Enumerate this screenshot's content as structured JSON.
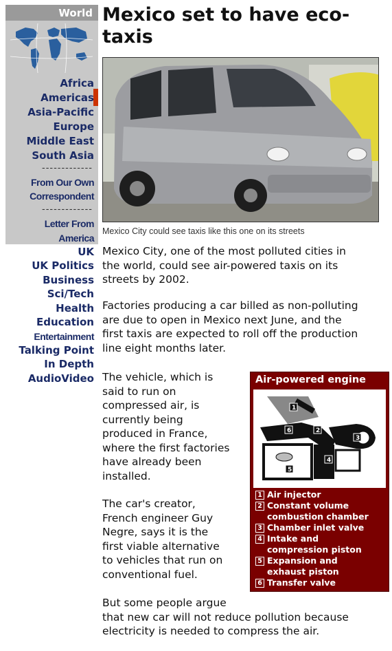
{
  "nav": {
    "world_label": "World",
    "regions": [
      "Africa",
      "Americas",
      "Asia-Pacific",
      "Europe",
      "Middle East",
      "South Asia"
    ],
    "dash_line": "-------------",
    "from_our_own": [
      "From Our Own",
      "Correspondent"
    ],
    "letter_from": [
      "Letter From",
      "America"
    ],
    "sections": [
      "UK",
      "UK Politics",
      "Business",
      "Sci/Tech",
      "Health",
      "Education",
      "Entertainment",
      "Talking Point",
      "In Depth",
      "AudioVideo"
    ],
    "active": "Americas"
  },
  "article": {
    "headline_line1": "Mexico set to have eco-",
    "headline_line2": "taxis",
    "photo_caption": "Mexico City could see taxis like this one on its streets",
    "paragraph1": "Mexico City, one of the most polluted cities in\nthe world, could see air-powered taxis on its\nstreets by 2002.",
    "paragraph2": "Factories producing a car billed as non-polluting\nare due to open in Mexico next June, and the\nfirst taxis are expected to roll off the production\nline eight months later.",
    "paragraph3": "The vehicle, which is\nsaid to run on\ncompressed air, is\ncurrently being\nproduced in France,\nwhere the first factories\nhave already been\ninstalled.",
    "paragraph4": "The car's creator,\nFrench engineer Guy\nNegre, says it is the\nfirst viable alternative\nto vehicles that run on\nconventional fuel.",
    "paragraph5": "But some people argue\nthat new car will not reduce pollution because\nelectricity is needed to compress the air."
  },
  "engine_box": {
    "title": "Air-powered engine",
    "diagram_numbers": [
      "1",
      "2",
      "3",
      "4",
      "5",
      "6"
    ],
    "legend": [
      {
        "num": "1",
        "lines": [
          "Air injector"
        ]
      },
      {
        "num": "2",
        "lines": [
          "Constant volume",
          "combustion chamber"
        ]
      },
      {
        "num": "3",
        "lines": [
          "Chamber inlet valve"
        ]
      },
      {
        "num": "4",
        "lines": [
          "Intake and",
          "compression piston"
        ]
      },
      {
        "num": "5",
        "lines": [
          "Expansion and",
          "exhaust piston"
        ]
      },
      {
        "num": "6",
        "lines": [
          "Transfer valve"
        ]
      }
    ]
  },
  "colors": {
    "nav_background": "#c8c8c8",
    "nav_link": "#1a2a66",
    "active_marker": "#cc3300",
    "engine_box": "#7a0000"
  }
}
